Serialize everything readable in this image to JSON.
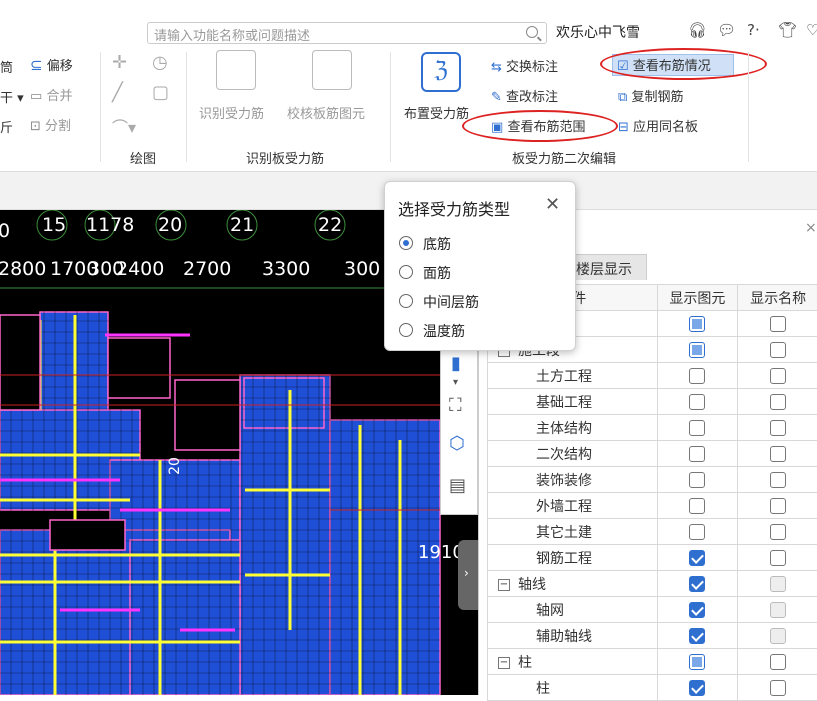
{
  "topbar": {
    "search_placeholder": "请输入功能名称或问题描述",
    "user_name": "欢乐心中飞雪",
    "icons": [
      "headset-icon",
      "chat-icon",
      "help-icon",
      "shirt-icon",
      "heart-icon"
    ],
    "help_label": "?·"
  },
  "ribbon": {
    "left_partial": {
      "item1": "筒",
      "item2": "干 ▾",
      "item3": "斤"
    },
    "modify": {
      "offset": "偏移",
      "merge": "合并",
      "split": "分割"
    },
    "draw_group": "绘图",
    "identify_group": {
      "label": "识别板受力筋",
      "identify_btn": "识别受力筋",
      "check_btn": "校核板筋图元"
    },
    "place_btn": "布置受力筋",
    "edit_group": {
      "label": "板受力筋二次编辑",
      "swap_label": "交换标注",
      "edit_label": "查改标注",
      "view_range": "查看布筋范围",
      "view_status": "查看布筋情况",
      "copy_rebar": "复制钢筋",
      "apply_same": "应用同名板"
    }
  },
  "canvas": {
    "axis_labels": [
      "0",
      "15",
      "1178",
      "20",
      "21",
      "22"
    ],
    "dimensions": [
      "2800",
      "1700",
      "300",
      "2400",
      "2700",
      "3300",
      "300"
    ],
    "annotation_1910": "1910",
    "annotation_20": "20"
  },
  "dialog": {
    "title": "选择受力筋类型",
    "options": [
      "底筋",
      "面筋",
      "中间层筋",
      "温度筋"
    ],
    "selected": "底筋"
  },
  "right_panel": {
    "tab": "楼层显示",
    "close": "×",
    "headers": [
      "构件",
      "显示图元",
      "显示名称"
    ],
    "rows": [
      {
        "label": "",
        "indent": 0,
        "show": "partial",
        "name": "off"
      },
      {
        "label": "施工段",
        "indent": 0,
        "expander": "−",
        "show": "partial",
        "name": "off"
      },
      {
        "label": "土方工程",
        "indent": 1,
        "show": "off",
        "name": "off"
      },
      {
        "label": "基础工程",
        "indent": 1,
        "show": "off",
        "name": "off"
      },
      {
        "label": "主体结构",
        "indent": 1,
        "show": "off",
        "name": "off"
      },
      {
        "label": "二次结构",
        "indent": 1,
        "show": "off",
        "name": "off"
      },
      {
        "label": "装饰装修",
        "indent": 1,
        "show": "off",
        "name": "off"
      },
      {
        "label": "外墙工程",
        "indent": 1,
        "show": "off",
        "name": "off"
      },
      {
        "label": "其它土建",
        "indent": 1,
        "show": "off",
        "name": "off"
      },
      {
        "label": "钢筋工程",
        "indent": 1,
        "show": "on",
        "name": "off"
      },
      {
        "label": "轴线",
        "indent": 0,
        "expander": "−",
        "show": "on",
        "name": "disabled"
      },
      {
        "label": "轴网",
        "indent": 1,
        "show": "on",
        "name": "disabled"
      },
      {
        "label": "辅助轴线",
        "indent": 1,
        "show": "on",
        "name": "disabled"
      },
      {
        "label": "柱",
        "indent": 0,
        "expander": "−",
        "show": "partial",
        "name": "off"
      },
      {
        "label": "柱",
        "indent": 1,
        "show": "on",
        "name": "off"
      }
    ]
  },
  "colors": {
    "accent": "#2f6fd0",
    "highlight_oval": "#d22222",
    "canvas_bg": "#000000",
    "plate_blue": "#1f4fd6"
  }
}
